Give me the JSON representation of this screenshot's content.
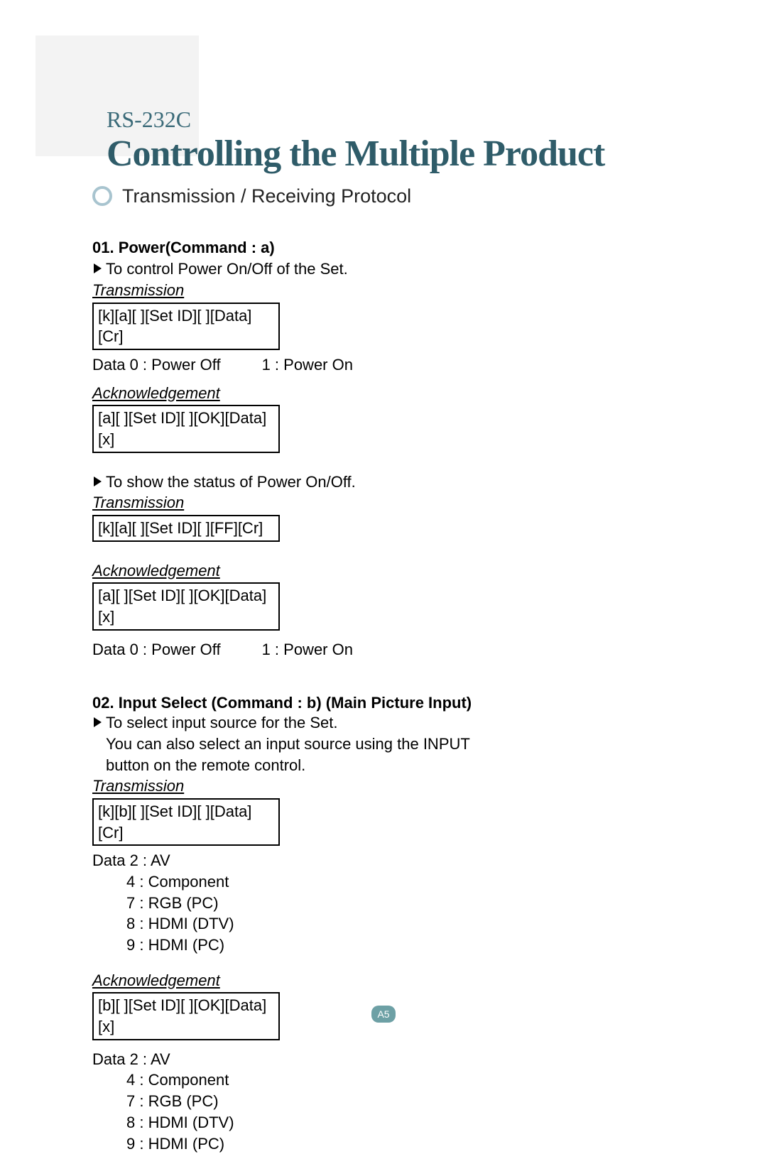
{
  "header": {
    "prefix": "RS-232C",
    "title": "Controlling the Multiple Product"
  },
  "section_title": "Transmission / Receiving Protocol",
  "cmd1": {
    "title": "01. Power(Command : a)",
    "desc1": "To control Power On/Off of the Set.",
    "tx1_label": "Transmission",
    "tx1_box": "[k][a][ ][Set ID][ ][Data][Cr]",
    "data_line_a": "Data 0 : Power Off",
    "data_line_b": "1 : Power On",
    "ack1_label": "Acknowledgement",
    "ack1_box": "[a][ ][Set ID][ ][OK][Data][x]",
    "desc2": "To show the status of Power On/Off.",
    "tx2_label": "Transmission",
    "tx2_box": "[k][a][ ][Set ID][ ][FF][Cr]",
    "ack2_label": "Acknowledgement",
    "ack2_box": "[a][ ][Set ID][ ][OK][Data][x]",
    "data2_a": "Data 0 : Power Off",
    "data2_b": "1 : Power On"
  },
  "cmd2": {
    "title": "02. Input Select (Command : b) (Main Picture Input)",
    "desc1a": "To select input source for the Set.",
    "desc1b": "You can also select an input source using the INPUT",
    "desc1c": "button on the remote control.",
    "tx_label": "Transmission",
    "tx_box": "[k][b][ ][Set ID][ ][Data][Cr]",
    "list_head": "Data  2 : AV",
    "list_4": "4 : Component",
    "list_7": "7 : RGB (PC)",
    "list_8": "8 : HDMI (DTV)",
    "list_9": "9 : HDMI (PC)",
    "ack_label": "Acknowledgement",
    "ack_box": "[b][ ][Set ID][ ][OK][Data][x]",
    "list2_head": "Data  2 : AV",
    "list2_4": "4 : Component",
    "list2_7": "7 : RGB (PC)",
    "list2_8": "8 : HDMI (DTV)",
    "list2_9": "9 : HDMI (PC)"
  },
  "page_number": "A5"
}
